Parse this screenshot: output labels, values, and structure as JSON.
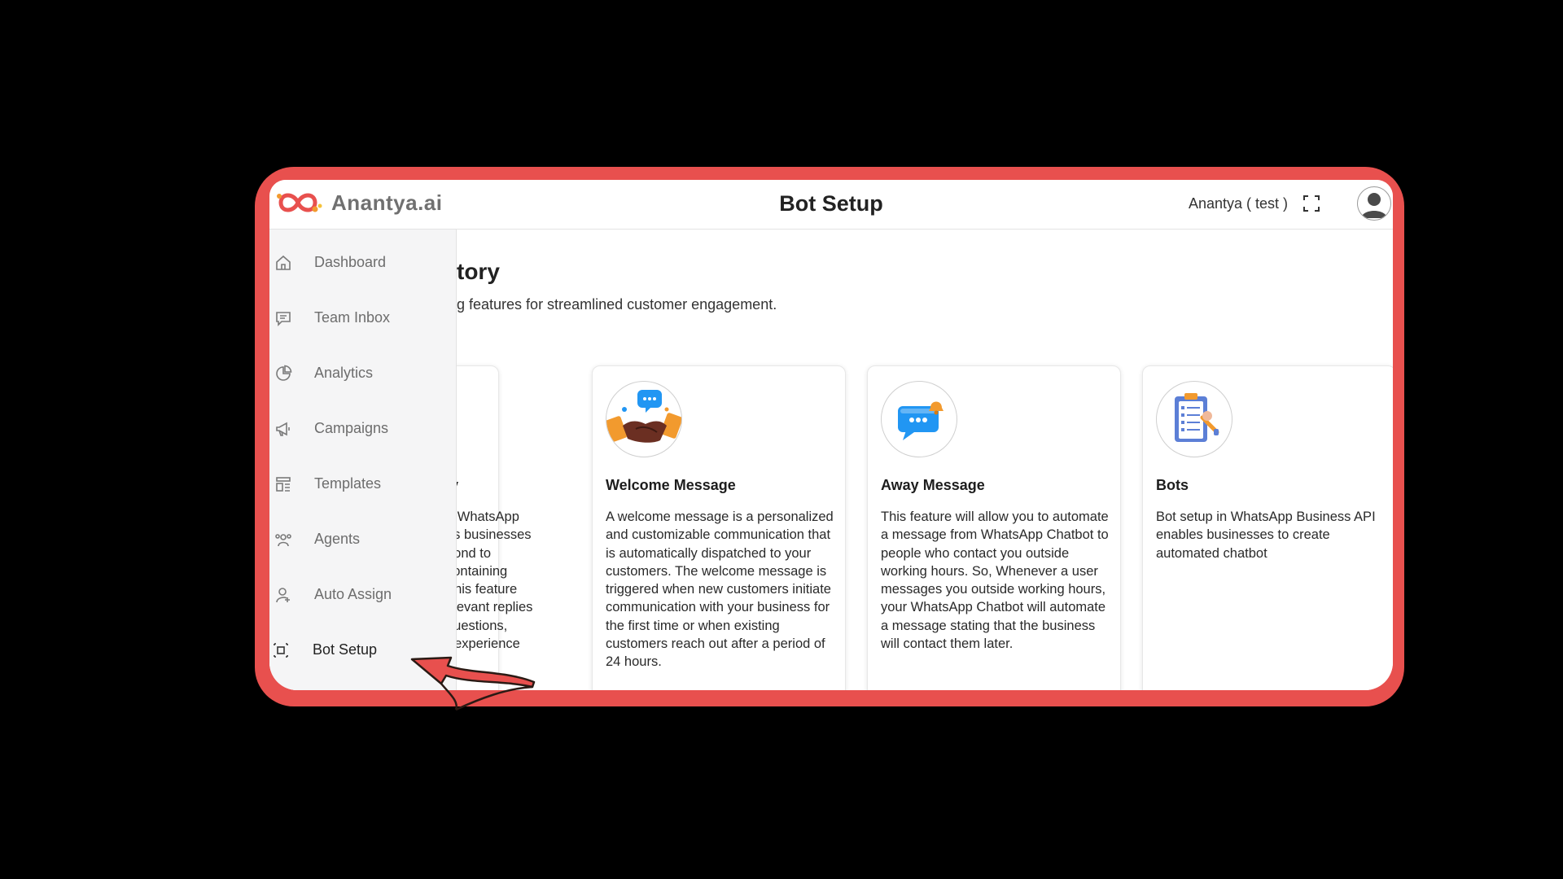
{
  "app": {
    "logo_text": "Anantya.ai",
    "page_title": "Bot Setup",
    "account_name": "Anantya ( test )"
  },
  "sidebar": {
    "items": [
      {
        "label": "Dashboard",
        "icon": "home-icon"
      },
      {
        "label": "Team Inbox",
        "icon": "chat-icon"
      },
      {
        "label": "Analytics",
        "icon": "pie-chart-icon"
      },
      {
        "label": "Campaigns",
        "icon": "megaphone-icon"
      },
      {
        "label": "Templates",
        "icon": "template-icon"
      },
      {
        "label": "Agents",
        "icon": "agents-icon"
      },
      {
        "label": "Auto Assign",
        "icon": "user-assign-icon"
      },
      {
        "label": "Bot Setup",
        "icon": "bot-setup-icon",
        "active": true
      }
    ]
  },
  "main": {
    "title": "tory",
    "subtitle": "g features for streamlined customer engagement."
  },
  "cards": [
    {
      "title": "ly",
      "desc": "n WhatsApp\nes businesses\npond to\n containing\nThis feature\nelevant replies\nquestions,\nr experience"
    },
    {
      "title": "Welcome Message",
      "icon": "handshake-icon",
      "desc": "A welcome message is a personalized and customizable communication that is automatically dispatched to your customers. The welcome message is triggered when new customers initiate communication with your business for the first time or when existing customers reach out after a period of 24 hours."
    },
    {
      "title": "Away Message",
      "icon": "chat-bell-icon",
      "desc": "This feature will allow you to automate a message from WhatsApp Chatbot to people who contact you outside working hours. So, Whenever a user messages you outside working hours, your WhatsApp Chatbot will automate a message stating that the business will contact them later."
    },
    {
      "title": "Bots",
      "icon": "clipboard-icon",
      "desc": "Bot setup in WhatsApp Business API enables businesses to create automated chatbot"
    }
  ],
  "colors": {
    "frame": "#e8504e",
    "sidebar_bg": "#f5f5f6",
    "accent_blue": "#2196f3",
    "accent_orange": "#f29a2e"
  }
}
